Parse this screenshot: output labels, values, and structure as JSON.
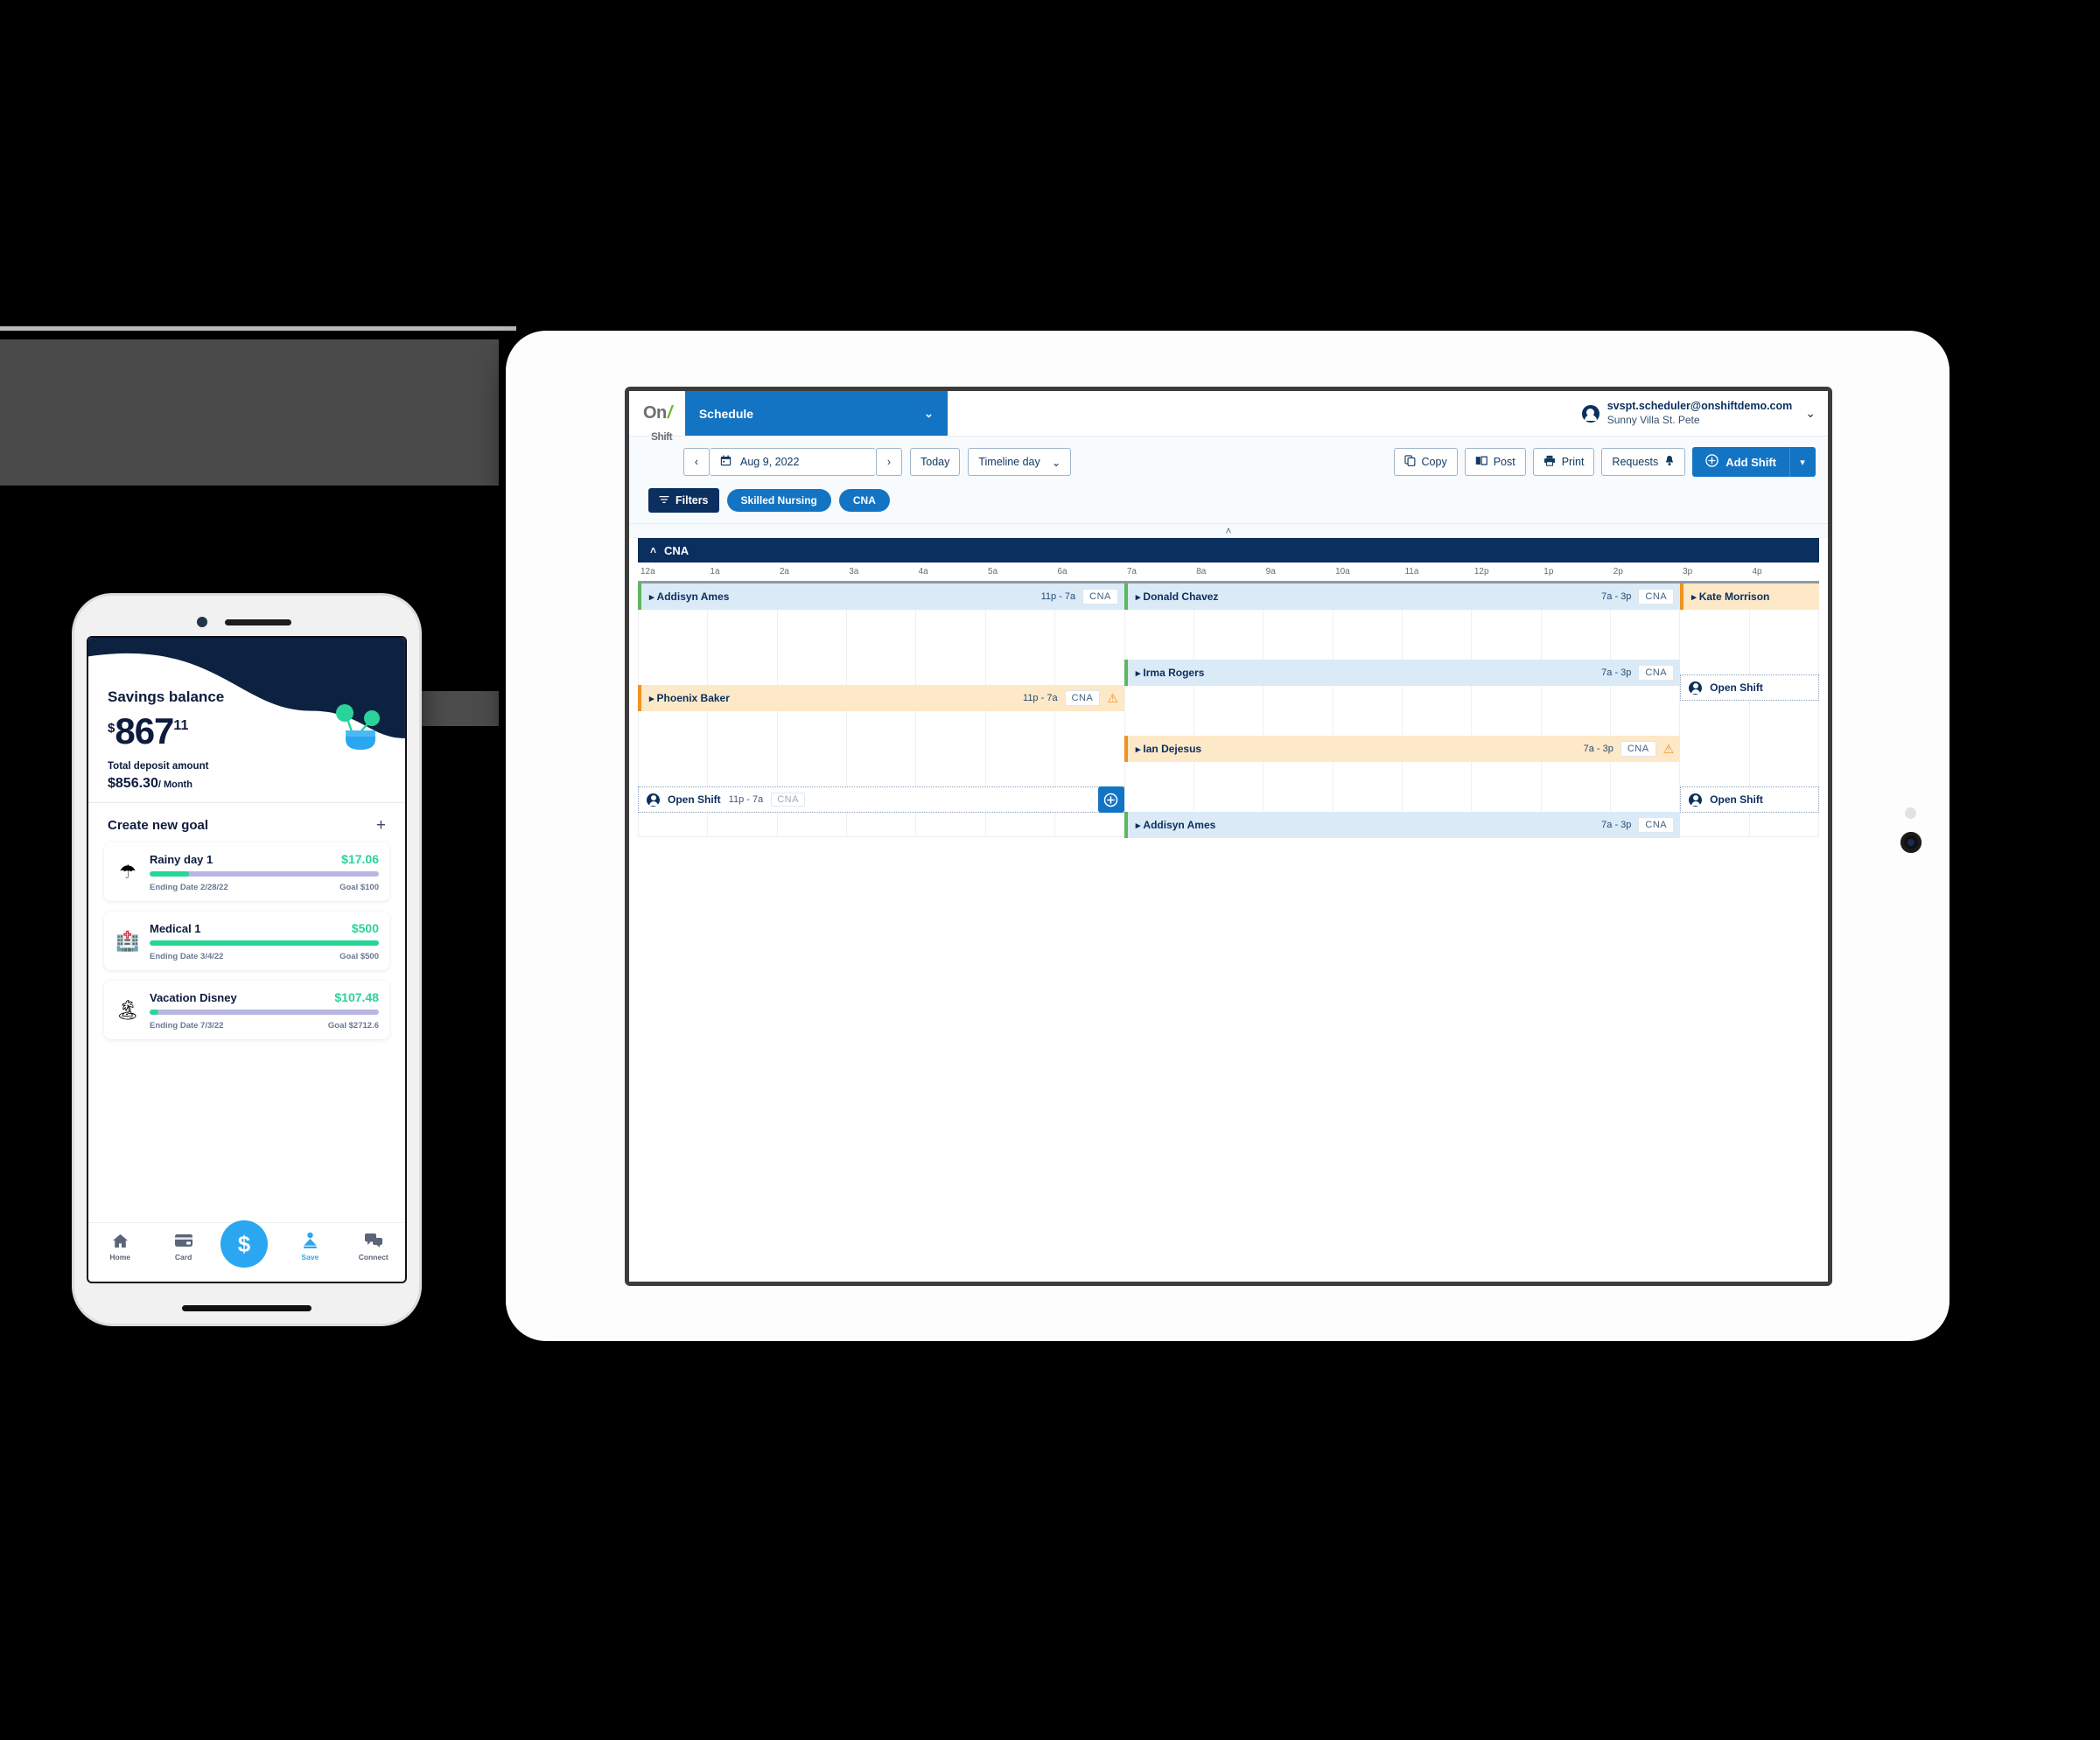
{
  "tablet_app": {
    "logo": {
      "on": "On",
      "slash": "/",
      "shift": "Shift"
    },
    "nav_select": {
      "label": "Schedule",
      "caret": "⌄"
    },
    "user": {
      "email": "svspt.scheduler@onshiftdemo.com",
      "site": "Sunny Villa St. Pete",
      "caret": "⌄"
    },
    "toolbar": {
      "prev": "‹",
      "next": "›",
      "date": "Aug 9, 2022",
      "today": "Today",
      "view": "Timeline day",
      "view_caret": "⌄",
      "copy": "Copy",
      "post": "Post",
      "print": "Print",
      "requests": "Requests",
      "add_shift": "Add Shift",
      "add_shift_caret": "▾"
    },
    "filters": {
      "filters_label": "Filters",
      "chips": [
        "Skilled Nursing",
        "CNA"
      ]
    },
    "collapse_caret": "˄",
    "group": {
      "caret": "˄",
      "label": "CNA"
    },
    "hours": [
      "12a",
      "1a",
      "2a",
      "3a",
      "4a",
      "5a",
      "6a",
      "7a",
      "8a",
      "9a",
      "10a",
      "11a",
      "12p",
      "1p",
      "2p",
      "3p",
      "4p"
    ],
    "shifts": [
      {
        "name": "Addisyn Ames",
        "time": "11p - 7a",
        "role": "CNA",
        "color": "blue",
        "warn": false,
        "row": 0,
        "start": 0,
        "span": 7
      },
      {
        "name": "Donald Chavez",
        "time": "7a - 3p",
        "role": "CNA",
        "color": "blue",
        "warn": false,
        "row": 0,
        "start": 7,
        "span": 8
      },
      {
        "name": "Kate Morrison",
        "time": "",
        "role": "",
        "color": "orange",
        "warn": false,
        "row": 0,
        "start": 15,
        "span": 2
      },
      {
        "name": "Irma Rogers",
        "time": "7a - 3p",
        "role": "CNA",
        "color": "blue",
        "warn": false,
        "row": 3,
        "start": 7,
        "span": 8
      },
      {
        "name": "Phoenix Baker",
        "time": "11p - 7a",
        "role": "CNA",
        "color": "orange",
        "warn": true,
        "row": 4,
        "start": 0,
        "span": 7
      },
      {
        "name": "Ian Dejesus",
        "time": "7a - 3p",
        "role": "CNA",
        "color": "orange",
        "warn": true,
        "row": 6,
        "start": 7,
        "span": 8
      },
      {
        "name": "Addisyn Ames",
        "time": "7a - 3p",
        "role": "CNA",
        "color": "blue",
        "warn": false,
        "row": 9,
        "start": 7,
        "span": 8
      }
    ],
    "open_shifts": [
      {
        "label": "Open Shift",
        "time": "11p - 7a",
        "role": "CNA",
        "row": 8,
        "start": 0,
        "span": 7,
        "has_add": true
      },
      {
        "label": "Open Shift",
        "time": "",
        "role": "",
        "row": 3.6,
        "start": 15,
        "span": 2,
        "has_add": false
      },
      {
        "label": "Open Shift",
        "time": "",
        "role": "",
        "row": 8,
        "start": 15,
        "span": 2,
        "has_add": false
      }
    ],
    "colors": {
      "primary": "#1474c4",
      "navy": "#0b2f5e",
      "shift_blue": "#dbeaf7",
      "shift_orange": "#fde8c8",
      "green_bar": "#5cb85c",
      "orange_bar": "#f0921f"
    }
  },
  "phone_app": {
    "hero": {
      "title": "Savings balance",
      "currency": "$",
      "amount": "867",
      "cents": "11",
      "deposit_label": "Total deposit amount",
      "deposit_amount": "$856.30",
      "deposit_period": "/ Month"
    },
    "goals_header": {
      "title": "Create new goal",
      "plus": "+"
    },
    "goals": [
      {
        "emoji": "☂",
        "name": "Rainy day 1",
        "amount": "$17.06",
        "progress": 17,
        "ending": "Ending Date 2/28/22",
        "goal": "Goal $100"
      },
      {
        "emoji": "🏥",
        "name": "Medical 1",
        "amount": "$500",
        "progress": 100,
        "ending": "Ending Date 3/4/22",
        "goal": "Goal $500"
      },
      {
        "emoji": "🏝",
        "name": "Vacation Disney",
        "amount": "$107.48",
        "progress": 4,
        "ending": "Ending Date 7/3/22",
        "goal": "Goal $2712.6"
      }
    ],
    "nav": [
      {
        "icon": "home-icon",
        "label": "Home",
        "active": false
      },
      {
        "icon": "card-icon",
        "label": "Card",
        "active": false
      },
      {
        "icon": "dollar-fab-icon",
        "label": "",
        "active": false
      },
      {
        "icon": "save-icon",
        "label": "Save",
        "active": true
      },
      {
        "icon": "connect-icon",
        "label": "Connect",
        "active": false
      }
    ]
  }
}
